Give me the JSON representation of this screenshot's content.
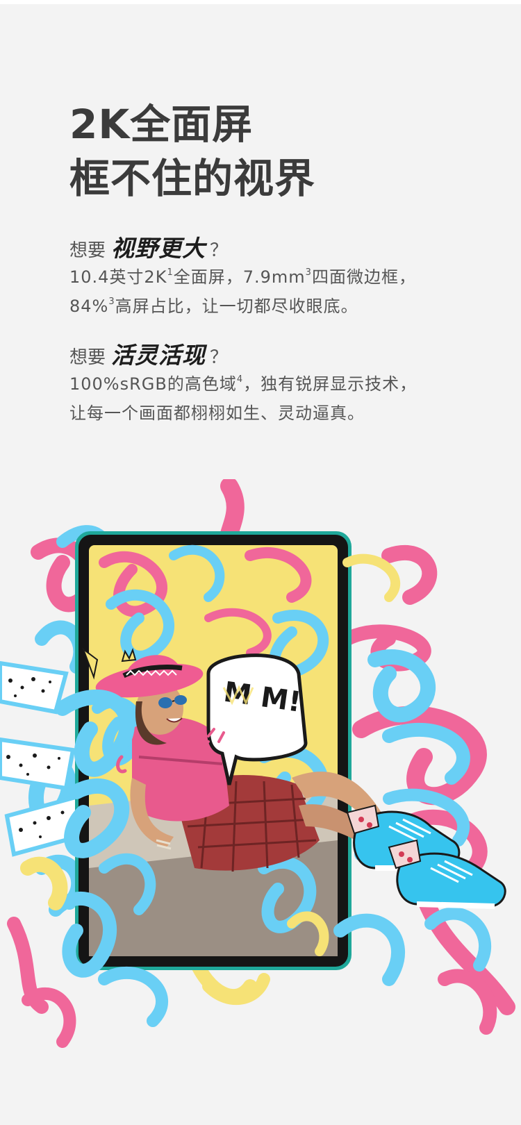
{
  "headline": {
    "line1": "2K全面屏",
    "line2": "框不住的视界"
  },
  "section1": {
    "prefix": "想要",
    "emphasis": "视野更大",
    "suffix": "？",
    "line1_a": "10.4英寸2K",
    "line1_sup1": "1",
    "line1_b": "全面屏，7.9mm",
    "line1_sup2": "3",
    "line1_c": "四面微边框，",
    "line2_a": "84%",
    "line2_sup": "3",
    "line2_b": "高屏占比，让一切都尽收眼底。"
  },
  "section2": {
    "prefix": "想要",
    "emphasis": "活灵活现",
    "suffix": "？",
    "line1_a": "100%sRGB的高色域",
    "line1_sup": "4",
    "line1_b": "，独有锐屏显示技术，",
    "line2": "让每一个画面都栩栩如生、灵动逼真。"
  },
  "illustration": {
    "speech_bubble_text": "M M!",
    "colors": {
      "tablet_frame": "#1fa89a",
      "screen_bezel": "#151515",
      "yellow_bg": "#f6e276",
      "pink": "#f0679a",
      "sky_blue": "#69cff5",
      "hat_pink": "#ef5c92",
      "top_pink": "#e85a8d",
      "skirt_red": "#a33a3a",
      "shoe_blue": "#36c4ee"
    }
  }
}
